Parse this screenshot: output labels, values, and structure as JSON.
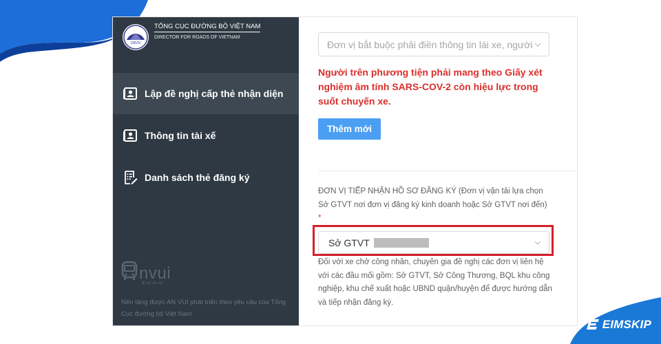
{
  "sidebar": {
    "org_name_vn": "TỔNG CỤC ĐƯỜNG BỘ VIỆT NAM",
    "org_name_en": "DIRECTOR FOR ROADS OF VIETNAM",
    "logo_letters": "DRVN",
    "items": [
      {
        "label": "Lập đề nghị cấp thẻ nhận diện",
        "icon": "id-card-icon",
        "active": true
      },
      {
        "label": "Thông tin tài xế",
        "icon": "id-card-icon",
        "active": false
      },
      {
        "label": "Danh sách thẻ đăng ký",
        "icon": "list-checklist-icon",
        "active": false
      }
    ],
    "partner_logo": "nvui",
    "partner_tagline": "đi an về vui",
    "footer_text": "Nền tảng được AN VUI phát triển theo yêu cầu của Tổng Cục đường bộ Việt Nam"
  },
  "form": {
    "unit_select_placeholder": "Đơn vị bắt buộc phải điền thông tin lái xe, người",
    "warning_text": "Người trên phương tiện phải mang theo Giấy xét nghiệm âm tính SARS-COV-2 còn hiệu lực trong suốt chuyến xe.",
    "add_button_label": "Thêm mới",
    "receiving_unit_label": "ĐƠN VỊ TIẾP NHẬN HỒ SƠ ĐĂNG KÝ (Đơn vị vận tải lựa chọn Sở GTVT nơi đơn vị đăng ký kinh doanh hoặc Sở GTVT nơi đến)",
    "required_mark": "*",
    "receiving_unit_value": "Sở GTVT",
    "receiving_unit_note": "Đối với xe chở công nhân, chuyên gia đề nghị các đơn vị liên hệ với các đầu mối gồm: Sở GTVT, Sở Công Thương, BQL khu công nghiệp, khu chế xuất hoặc UBND quận/huyện để được hướng dẫn và tiếp nhận đăng ký."
  },
  "watermark": {
    "brand": "EIMSKIP"
  },
  "colors": {
    "sidebar_bg": "#2f3943",
    "sidebar_active": "#3d4852",
    "accent_blue": "#4b9ff3",
    "warning_red": "#d9302b",
    "highlight_red": "#d51f2a",
    "brand_blue": "#1a78d6"
  }
}
